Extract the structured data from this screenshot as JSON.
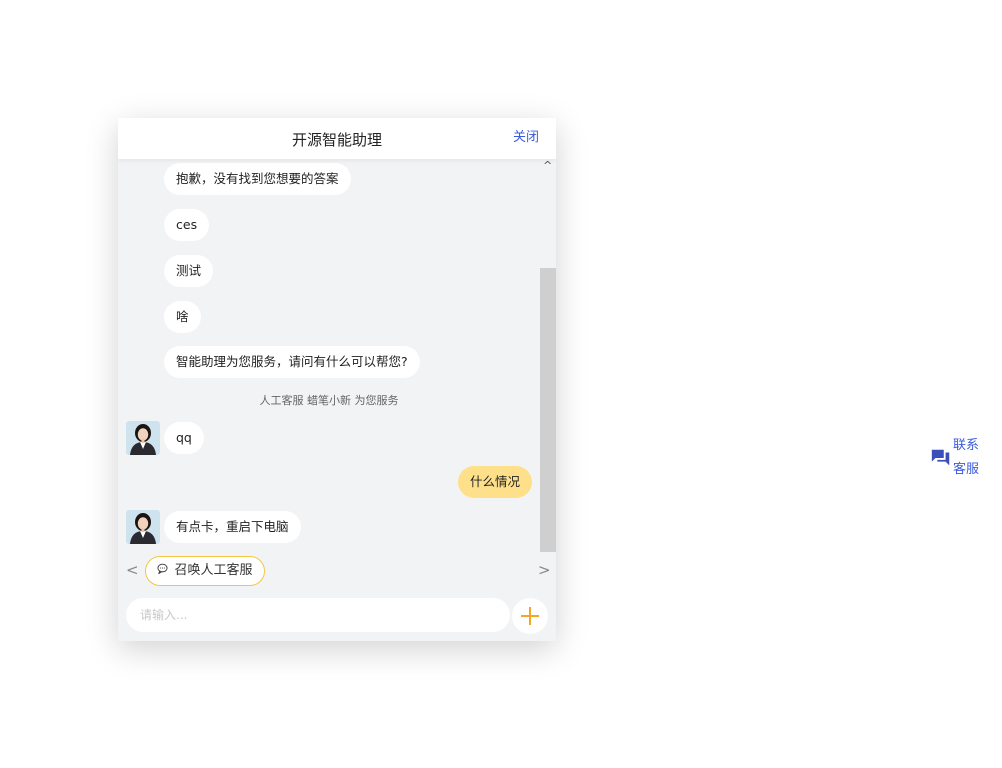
{
  "window": {
    "title": "开源智能助理",
    "close_label": "关闭"
  },
  "messages": [
    {
      "role": "bot",
      "text": "抱歉，没有找到您想要的答案",
      "avatar": false
    },
    {
      "role": "bot",
      "text": "ces",
      "avatar": false
    },
    {
      "role": "bot",
      "text": "测试",
      "avatar": false
    },
    {
      "role": "bot",
      "text": "啥",
      "avatar": false
    },
    {
      "role": "bot",
      "text": "智能助理为您服务，请问有什么可以帮您?",
      "avatar": false
    },
    {
      "role": "agent",
      "text": "qq",
      "avatar": true
    },
    {
      "role": "user",
      "text": "什么情况"
    },
    {
      "role": "agent",
      "text": "有点卡，重启下电脑",
      "avatar": true
    }
  ],
  "system_note": "人工客服 蜡笔小新 为您服务",
  "quick_replies": {
    "items": [
      {
        "icon": "chat-bubble-icon",
        "label": "召唤人工客服"
      }
    ]
  },
  "input": {
    "placeholder": "请输入...",
    "value": ""
  },
  "contact": {
    "label_line1": "联系",
    "label_line2": "客服",
    "icon": "forum-icon"
  },
  "colors": {
    "accent": "#3b5bdb",
    "user_bubble": "#ffe08a",
    "chip_border": "#f5c542",
    "plus": "#f5a623"
  }
}
